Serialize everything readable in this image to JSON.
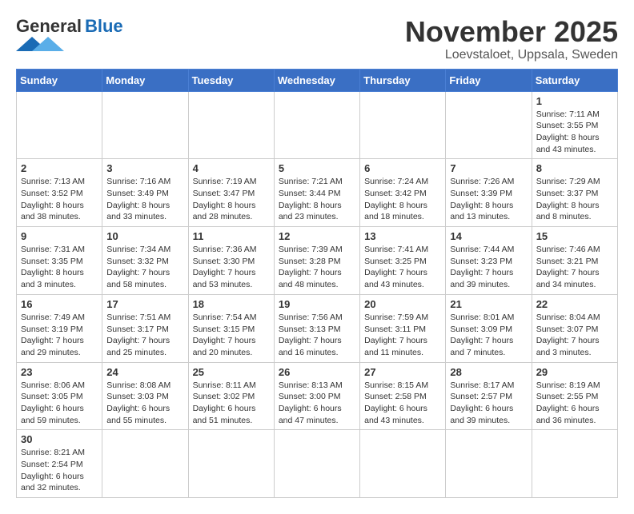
{
  "logo": {
    "general": "General",
    "blue": "Blue"
  },
  "header": {
    "month": "November 2025",
    "location": "Loevstaloet, Uppsala, Sweden"
  },
  "days_of_week": [
    "Sunday",
    "Monday",
    "Tuesday",
    "Wednesday",
    "Thursday",
    "Friday",
    "Saturday"
  ],
  "weeks": [
    [
      {
        "day": "",
        "info": ""
      },
      {
        "day": "",
        "info": ""
      },
      {
        "day": "",
        "info": ""
      },
      {
        "day": "",
        "info": ""
      },
      {
        "day": "",
        "info": ""
      },
      {
        "day": "",
        "info": ""
      },
      {
        "day": "1",
        "info": "Sunrise: 7:11 AM\nSunset: 3:55 PM\nDaylight: 8 hours and 43 minutes."
      }
    ],
    [
      {
        "day": "2",
        "info": "Sunrise: 7:13 AM\nSunset: 3:52 PM\nDaylight: 8 hours and 38 minutes."
      },
      {
        "day": "3",
        "info": "Sunrise: 7:16 AM\nSunset: 3:49 PM\nDaylight: 8 hours and 33 minutes."
      },
      {
        "day": "4",
        "info": "Sunrise: 7:19 AM\nSunset: 3:47 PM\nDaylight: 8 hours and 28 minutes."
      },
      {
        "day": "5",
        "info": "Sunrise: 7:21 AM\nSunset: 3:44 PM\nDaylight: 8 hours and 23 minutes."
      },
      {
        "day": "6",
        "info": "Sunrise: 7:24 AM\nSunset: 3:42 PM\nDaylight: 8 hours and 18 minutes."
      },
      {
        "day": "7",
        "info": "Sunrise: 7:26 AM\nSunset: 3:39 PM\nDaylight: 8 hours and 13 minutes."
      },
      {
        "day": "8",
        "info": "Sunrise: 7:29 AM\nSunset: 3:37 PM\nDaylight: 8 hours and 8 minutes."
      }
    ],
    [
      {
        "day": "9",
        "info": "Sunrise: 7:31 AM\nSunset: 3:35 PM\nDaylight: 8 hours and 3 minutes."
      },
      {
        "day": "10",
        "info": "Sunrise: 7:34 AM\nSunset: 3:32 PM\nDaylight: 7 hours and 58 minutes."
      },
      {
        "day": "11",
        "info": "Sunrise: 7:36 AM\nSunset: 3:30 PM\nDaylight: 7 hours and 53 minutes."
      },
      {
        "day": "12",
        "info": "Sunrise: 7:39 AM\nSunset: 3:28 PM\nDaylight: 7 hours and 48 minutes."
      },
      {
        "day": "13",
        "info": "Sunrise: 7:41 AM\nSunset: 3:25 PM\nDaylight: 7 hours and 43 minutes."
      },
      {
        "day": "14",
        "info": "Sunrise: 7:44 AM\nSunset: 3:23 PM\nDaylight: 7 hours and 39 minutes."
      },
      {
        "day": "15",
        "info": "Sunrise: 7:46 AM\nSunset: 3:21 PM\nDaylight: 7 hours and 34 minutes."
      }
    ],
    [
      {
        "day": "16",
        "info": "Sunrise: 7:49 AM\nSunset: 3:19 PM\nDaylight: 7 hours and 29 minutes."
      },
      {
        "day": "17",
        "info": "Sunrise: 7:51 AM\nSunset: 3:17 PM\nDaylight: 7 hours and 25 minutes."
      },
      {
        "day": "18",
        "info": "Sunrise: 7:54 AM\nSunset: 3:15 PM\nDaylight: 7 hours and 20 minutes."
      },
      {
        "day": "19",
        "info": "Sunrise: 7:56 AM\nSunset: 3:13 PM\nDaylight: 7 hours and 16 minutes."
      },
      {
        "day": "20",
        "info": "Sunrise: 7:59 AM\nSunset: 3:11 PM\nDaylight: 7 hours and 11 minutes."
      },
      {
        "day": "21",
        "info": "Sunrise: 8:01 AM\nSunset: 3:09 PM\nDaylight: 7 hours and 7 minutes."
      },
      {
        "day": "22",
        "info": "Sunrise: 8:04 AM\nSunset: 3:07 PM\nDaylight: 7 hours and 3 minutes."
      }
    ],
    [
      {
        "day": "23",
        "info": "Sunrise: 8:06 AM\nSunset: 3:05 PM\nDaylight: 6 hours and 59 minutes."
      },
      {
        "day": "24",
        "info": "Sunrise: 8:08 AM\nSunset: 3:03 PM\nDaylight: 6 hours and 55 minutes."
      },
      {
        "day": "25",
        "info": "Sunrise: 8:11 AM\nSunset: 3:02 PM\nDaylight: 6 hours and 51 minutes."
      },
      {
        "day": "26",
        "info": "Sunrise: 8:13 AM\nSunset: 3:00 PM\nDaylight: 6 hours and 47 minutes."
      },
      {
        "day": "27",
        "info": "Sunrise: 8:15 AM\nSunset: 2:58 PM\nDaylight: 6 hours and 43 minutes."
      },
      {
        "day": "28",
        "info": "Sunrise: 8:17 AM\nSunset: 2:57 PM\nDaylight: 6 hours and 39 minutes."
      },
      {
        "day": "29",
        "info": "Sunrise: 8:19 AM\nSunset: 2:55 PM\nDaylight: 6 hours and 36 minutes."
      }
    ],
    [
      {
        "day": "30",
        "info": "Sunrise: 8:21 AM\nSunset: 2:54 PM\nDaylight: 6 hours and 32 minutes."
      },
      {
        "day": "",
        "info": ""
      },
      {
        "day": "",
        "info": ""
      },
      {
        "day": "",
        "info": ""
      },
      {
        "day": "",
        "info": ""
      },
      {
        "day": "",
        "info": ""
      },
      {
        "day": "",
        "info": ""
      }
    ]
  ]
}
